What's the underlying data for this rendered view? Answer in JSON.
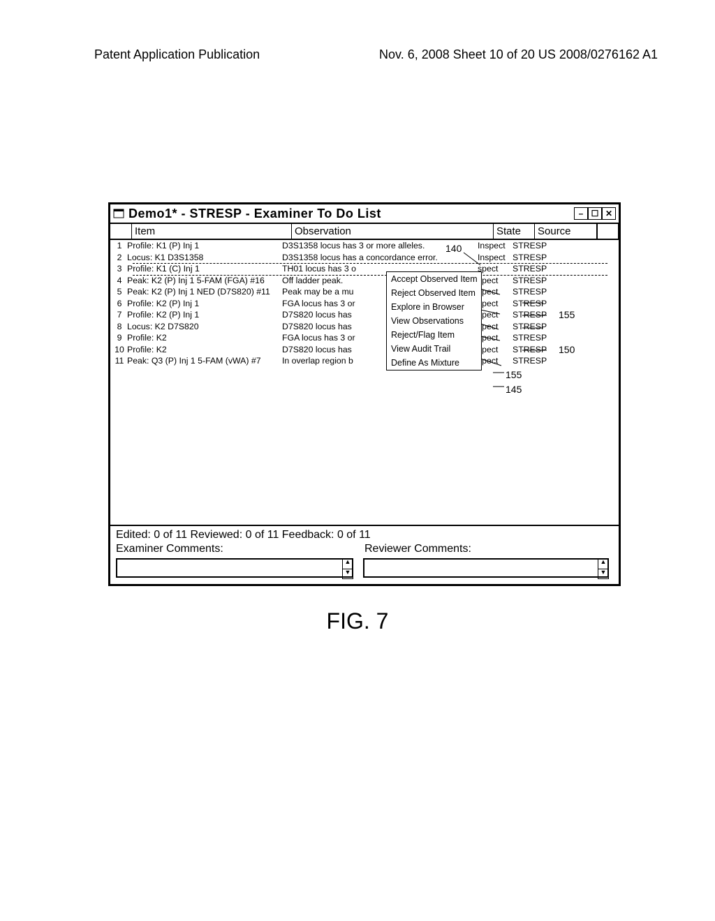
{
  "page_header": {
    "left": "Patent Application Publication",
    "right": "Nov. 6, 2008  Sheet 10 of 20     US 2008/0276162 A1"
  },
  "window": {
    "title": "Demo1* - STRESP - Examiner To Do List",
    "columns": {
      "num": "",
      "item": "Item",
      "obs": "Observation",
      "state": "State",
      "source": "Source"
    },
    "rows": [
      {
        "n": "1",
        "item": "Profile: K1 (P) Inj 1",
        "obs": "D3S1358 locus has 3 or more alleles.",
        "state": "Inspect",
        "source": "STRESP"
      },
      {
        "n": "2",
        "item": "Locus: K1 D3S1358",
        "obs": "D3S1358 locus has a concordance error.",
        "state": "Inspect",
        "source": "STRESP"
      },
      {
        "n": "3",
        "item": "Profile: K1 (C) Inj 1",
        "obs": "TH01 locus has 3 o",
        "state": "spect",
        "source": "STRESP"
      },
      {
        "n": "4",
        "item": "Peak: K2 (P) Inj 1 5-FAM (FGA) #16",
        "obs": "Off ladder peak.",
        "state": "spect",
        "source": "STRESP"
      },
      {
        "n": "5",
        "item": "Peak: K2 (P) Inj 1 NED (D7S820) #11",
        "obs": "Peak may be a mu",
        "state": "spect",
        "source": "STRESP"
      },
      {
        "n": "6",
        "item": "Profile: K2 (P) Inj 1",
        "obs": "FGA locus has 3 or",
        "state": "spect",
        "source": "STRESP"
      },
      {
        "n": "7",
        "item": "Profile: K2 (P) Inj 1",
        "obs": "D7S820 locus has",
        "state": "spect",
        "source": "STRESP"
      },
      {
        "n": "8",
        "item": "Locus: K2 D7S820",
        "obs": "D7S820 locus has",
        "state": "spect",
        "source": "STRESP"
      },
      {
        "n": "9",
        "item": "Profile: K2",
        "obs": "FGA locus has 3 or",
        "state": "spect",
        "source": "STRESP"
      },
      {
        "n": "10",
        "item": "Profile: K2",
        "obs": "D7S820 locus has",
        "state": "spect",
        "source": "STRESP"
      },
      {
        "n": "11",
        "item": "Peak: Q3 (P) Inj 1 5-FAM (vWA) #7",
        "obs": "In overlap region b",
        "state": "spect",
        "source": "STRESP"
      }
    ],
    "context_menu": [
      "Accept Observed Item",
      "Reject Observed Item",
      "Explore in Browser",
      "View Observations",
      "Reject/Flag Item",
      "View Audit Trail",
      "Define As Mixture"
    ],
    "footer": {
      "edited": "Edited:   0 of 11  Reviewed:   0 of 11     Feedback:   0 of 11",
      "examiner": "Examiner Comments:",
      "reviewer": "Reviewer Comments:"
    },
    "win_buttons": {
      "min": "–",
      "max": "☐",
      "close": "✕"
    }
  },
  "callouts": {
    "c140": "140",
    "c155a": "155",
    "c150": "150",
    "c155b": "155",
    "c145": "145"
  },
  "figure_label": "FIG. 7"
}
